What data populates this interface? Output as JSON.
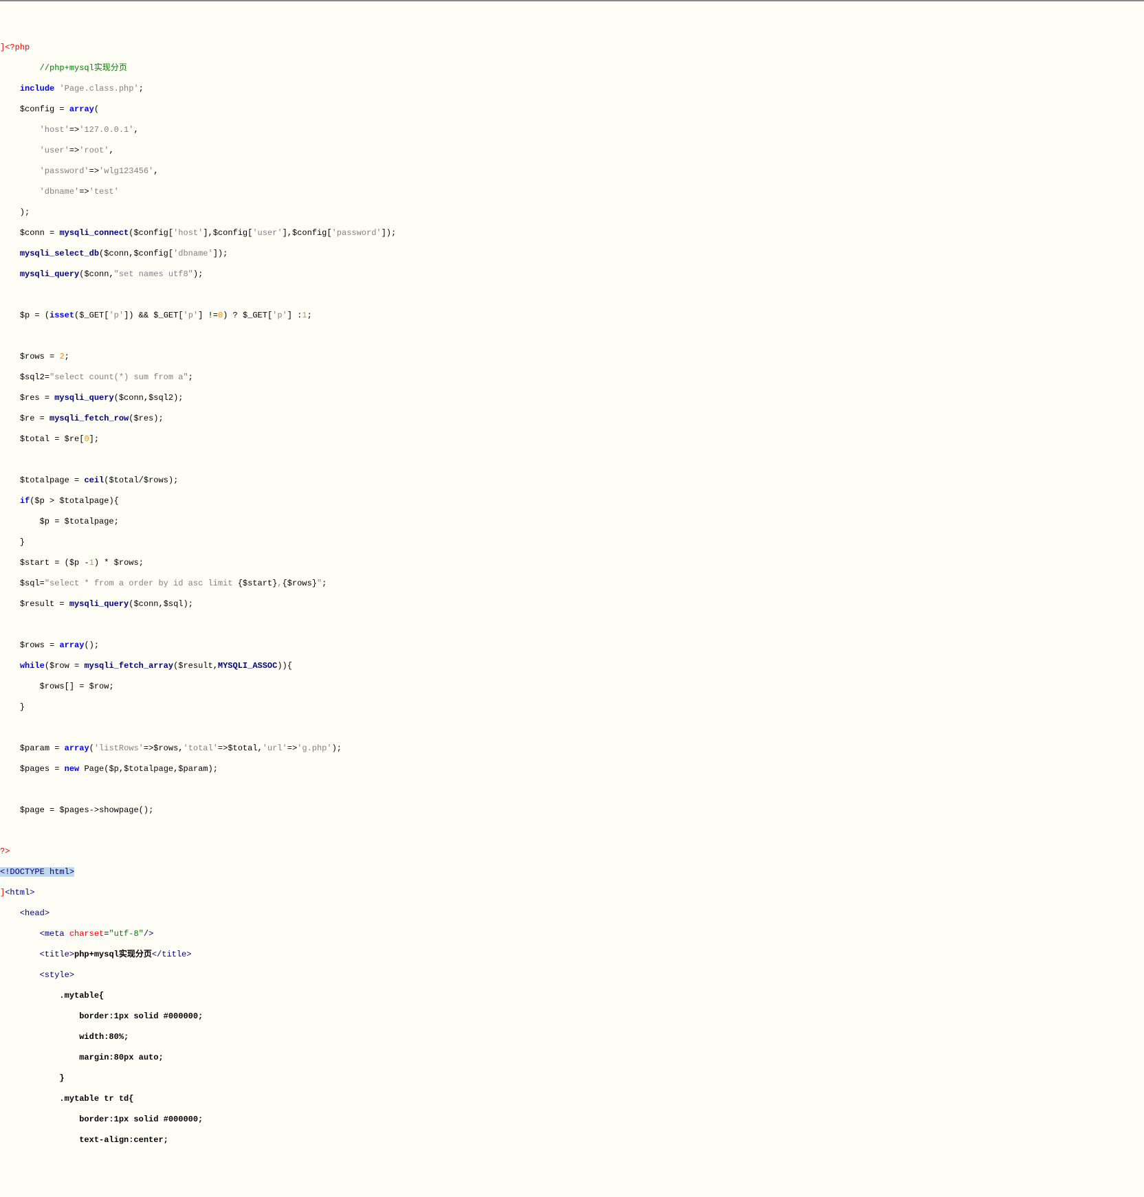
{
  "code": {
    "l1_open": "<?php",
    "l2_comment": "//php+mysql实现分页",
    "l3_inc": "include",
    "l3_str": "'Page.class.php'",
    "l4_var": "$config",
    "l4_arr": "array",
    "l5_k": "'host'",
    "l5_v": "'127.0.0.1'",
    "l6_k": "'user'",
    "l6_v": "'root'",
    "l7_k": "'password'",
    "l7_v": "'wlg123456'",
    "l8_k": "'dbname'",
    "l8_v": "'test'",
    "l10_var": "$conn",
    "l10_fn": "mysqli_connect",
    "l10_a1": "$config",
    "l10_k1": "'host'",
    "l10_k2": "'user'",
    "l10_k3": "'password'",
    "l11_fn": "mysqli_select_db",
    "l11_a1": "$conn",
    "l11_a2": "$config",
    "l11_k": "'dbname'",
    "l12_fn": "mysqli_query",
    "l12_a1": "$conn",
    "l12_str": "\"set names utf8\"",
    "l14_var": "$p",
    "l14_isset": "isset",
    "l14_get": "$_GET",
    "l14_k": "'p'",
    "l14_zero": "0",
    "l14_one": "1",
    "l16_var": "$rows",
    "l16_val": "2",
    "l17_var": "$sql2",
    "l17_str": "\"select count(*) sum from a\"",
    "l18_var": "$res",
    "l18_fn": "mysqli_query",
    "l18_a1": "$conn",
    "l18_a2": "$sql2",
    "l19_var": "$re",
    "l19_fn": "mysqli_fetch_row",
    "l19_a": "$res",
    "l20_var": "$total",
    "l20_src": "$re",
    "l20_idx": "0",
    "l22_var": "$totalpage",
    "l22_fn": "ceil",
    "l22_a": "$total",
    "l22_b": "$rows",
    "l23_if": "if",
    "l23_a": "$p",
    "l23_b": "$totalpage",
    "l24_a": "$p",
    "l24_b": "$totalpage",
    "l26_var": "$start",
    "l26_p": "$p",
    "l26_one": "1",
    "l26_rows": "$rows",
    "l27_var": "$sql",
    "l27_s1": "\"select * from a order by id asc limit ",
    "l27_e1": "{$start}",
    "l27_comma": ",",
    "l27_e2": "{$rows}",
    "l27_s2": "\"",
    "l28_var": "$result",
    "l28_fn": "mysqli_query",
    "l28_a1": "$conn",
    "l28_a2": "$sql",
    "l30_var": "$rows",
    "l30_arr": "array",
    "l31_while": "while",
    "l31_row": "$row",
    "l31_fn": "mysqli_fetch_array",
    "l31_a1": "$result",
    "l31_const": "MYSQLI_ASSOC",
    "l32_a": "$rows",
    "l32_b": "$row",
    "l35_var": "$param",
    "l35_arr": "array",
    "l35_k1": "'listRows'",
    "l35_v1": "$rows",
    "l35_k2": "'total'",
    "l35_v2": "$total",
    "l35_k3": "'url'",
    "l35_v3": "'g.php'",
    "l36_var": "$pages",
    "l36_new": "new",
    "l36_cls": "Page",
    "l36_a1": "$p",
    "l36_a2": "$totalpage",
    "l36_a3": "$param",
    "l38_var": "$page",
    "l38_obj": "$pages",
    "l38_meth": "showpage",
    "l40_close": "?>",
    "l41_doctype": "<!DOCTYPE html>",
    "l42_html_open": "<html>",
    "l43_head": "<head>",
    "l44_meta_t": "meta",
    "l44_meta_a": "charset",
    "l44_meta_v": "\"utf-8\"",
    "l45_title_o": "<title>",
    "l45_title_t": "php+mysql实现分页",
    "l45_title_c": "</title>",
    "l46_style": "<style>",
    "l47_sel": ".mytable{",
    "l48_css": "border:1px solid #000000;",
    "l49_css": "width:80%;",
    "l50_css": "margin:80px auto;",
    "l51_close": "}",
    "l52_sel": ".mytable tr td{",
    "l53_css": "border:1px solid #000000;",
    "l54_css": "text-align:center;"
  }
}
